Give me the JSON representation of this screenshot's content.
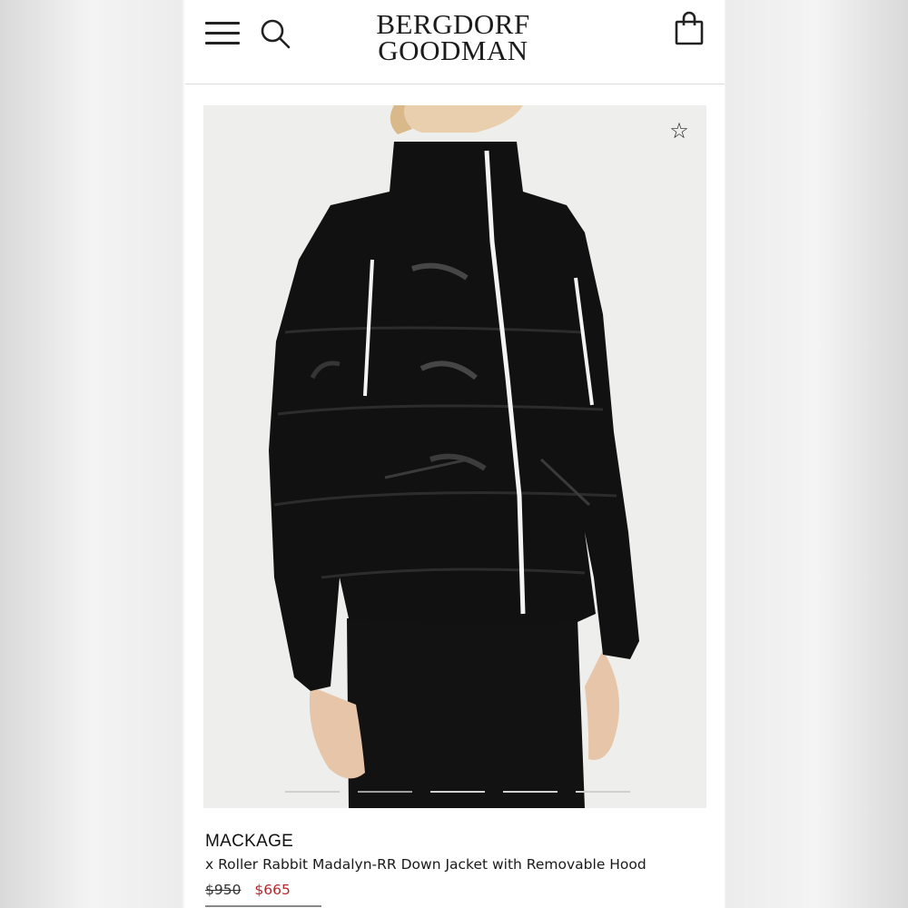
{
  "header": {
    "logo_line1": "BERGDORF",
    "logo_line2": "GOODMAN",
    "menu_icon": "hamburger-menu-icon",
    "search_icon": "search-icon",
    "bag_icon": "shopping-bag-icon"
  },
  "product": {
    "favorite_icon": "star-outline-icon",
    "brand": "MACKAGE",
    "name": "x Roller Rabbit Madalyn-RR Down Jacket with Removable Hood",
    "original_price": "$950",
    "sale_price": "$665",
    "image_count": 5,
    "active_image": 2
  },
  "colors": {
    "sale_price": "#b3262d",
    "image_background": "#eeeeec",
    "jacket": "#111111"
  }
}
